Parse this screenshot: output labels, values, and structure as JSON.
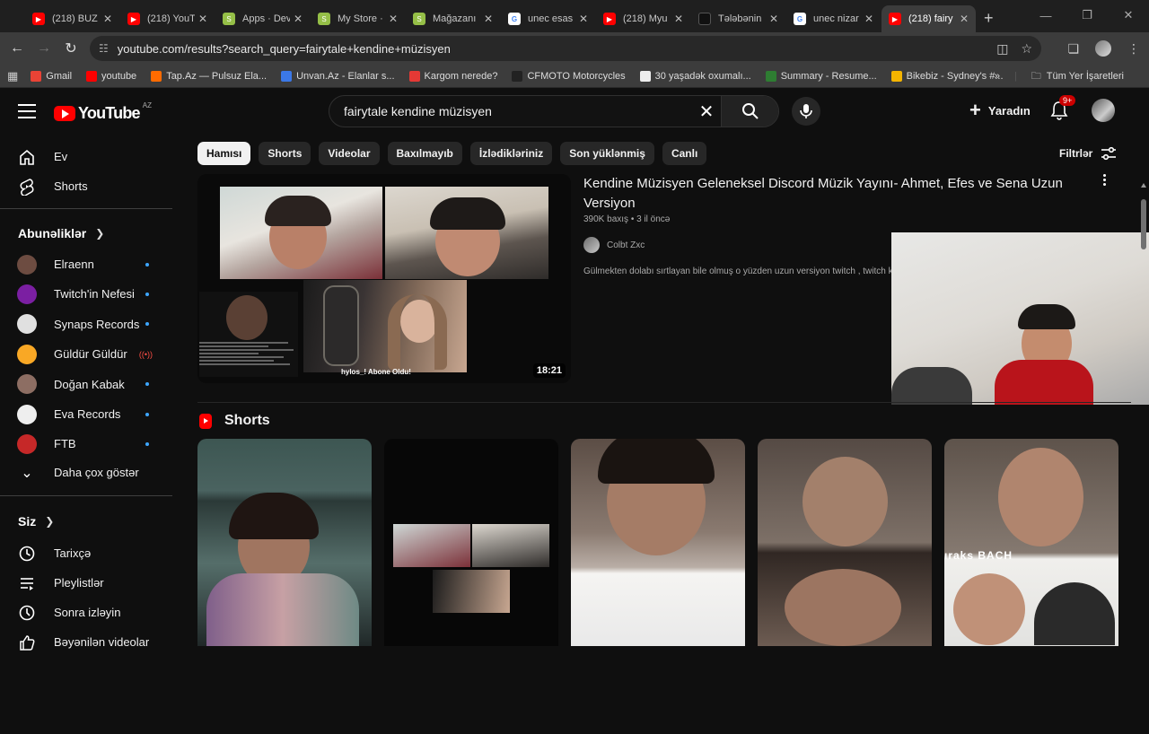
{
  "browser": {
    "tabs": [
      {
        "label": "(218) BUZ",
        "favicon": "youtube-favicon"
      },
      {
        "label": "(218) YouT",
        "favicon": "youtube-favicon"
      },
      {
        "label": "Apps · Dev",
        "favicon": "shopify-favicon"
      },
      {
        "label": "My Store ·",
        "favicon": "shopify-favicon"
      },
      {
        "label": "Mağazanı",
        "favicon": "shopify-favicon"
      },
      {
        "label": "unec esas",
        "favicon": "google-favicon"
      },
      {
        "label": "(218) Myu",
        "favicon": "youtube-favicon"
      },
      {
        "label": "Tələbənin",
        "favicon": "dark-favicon"
      },
      {
        "label": "unec nizar",
        "favicon": "google-favicon"
      },
      {
        "label": "(218) fairy",
        "favicon": "youtube-favicon",
        "active": true
      }
    ],
    "url": "youtube.com/results?search_query=fairytale+kendine+müzisyen",
    "bookmarks": [
      {
        "label": "Gmail",
        "color": "#ea4335"
      },
      {
        "label": "youtube",
        "color": "#ff0000"
      },
      {
        "label": "Tap.Az — Pulsuz Ela...",
        "color": "#ff6b00"
      },
      {
        "label": "Unvan.Az - Elanlar s...",
        "color": "#3b78e7"
      },
      {
        "label": "Kargom nerede?",
        "color": "#e53935"
      },
      {
        "label": "CFMOTO Motorcycles",
        "color": "#222222"
      },
      {
        "label": "30 yaşadək oxumalı...",
        "color": "#eeeeee"
      },
      {
        "label": "Summary - Resume...",
        "color": "#2e7d32"
      },
      {
        "label": "Bikebiz - Sydney's #...",
        "color": "#f4b400"
      }
    ],
    "bookmarks_more": "»",
    "all_bookmarks": "Tüm Yer İşaretleri"
  },
  "youtube": {
    "logo_text": "YouTube",
    "country_code": "AZ",
    "search_query": "fairytale kendine müzisyen",
    "create_label": "Yaradın",
    "notification_count": "9+",
    "sidebar": {
      "main": [
        {
          "label": "Ev",
          "icon": "home-icon"
        },
        {
          "label": "Shorts",
          "icon": "shorts-icon"
        }
      ],
      "subscriptions_title": "Abunəliklər",
      "subscriptions": [
        {
          "label": "Elraenn",
          "status": "dot",
          "color": "#6d4c41"
        },
        {
          "label": "Twitch'in Nefesi",
          "status": "dot",
          "color": "#7b1fa2"
        },
        {
          "label": "Synaps Records",
          "status": "dot",
          "color": "#e0e0e0"
        },
        {
          "label": "Güldür Güldür",
          "status": "live",
          "color": "#f9a825"
        },
        {
          "label": "Doğan Kabak",
          "status": "dot",
          "color": "#8d6e63"
        },
        {
          "label": "Eva Records",
          "status": "dot",
          "color": "#eeeeee"
        },
        {
          "label": "FTB",
          "status": "dot",
          "color": "#c62828"
        }
      ],
      "show_more": "Daha çox göstər",
      "you_title": "Siz",
      "you_items": [
        {
          "label": "Tarixçə",
          "icon": "history-icon"
        },
        {
          "label": "Pleylistlər",
          "icon": "playlists-icon"
        },
        {
          "label": "Sonra izləyin",
          "icon": "watch-later-icon"
        },
        {
          "label": "Bəyənilən videolar",
          "icon": "like-icon"
        }
      ]
    },
    "chips": [
      "Hamısı",
      "Shorts",
      "Videolar",
      "Baxılmayıb",
      "İzlədikləriniz",
      "Son yüklənmiş",
      "Canlı"
    ],
    "filters_label": "Filtrlər",
    "video": {
      "title": "Kendine Müzisyen Geleneksel Discord Müzik Yayını- Ahmet, Efes ve Sena Uzun Versiyon",
      "views": "390K baxış",
      "age": "3 il öncə",
      "channel": "Colbt Zxc",
      "description": "Gülmekten dolabı sırtlayan bile olmuş o yüzden uzun versiyon twitch , twitch k",
      "duration": "18:21",
      "overlay_text": "hylos_! Abone Oldu!"
    },
    "shorts_title": "Shorts",
    "shorts_overlay_text": "ıraks BACH"
  }
}
